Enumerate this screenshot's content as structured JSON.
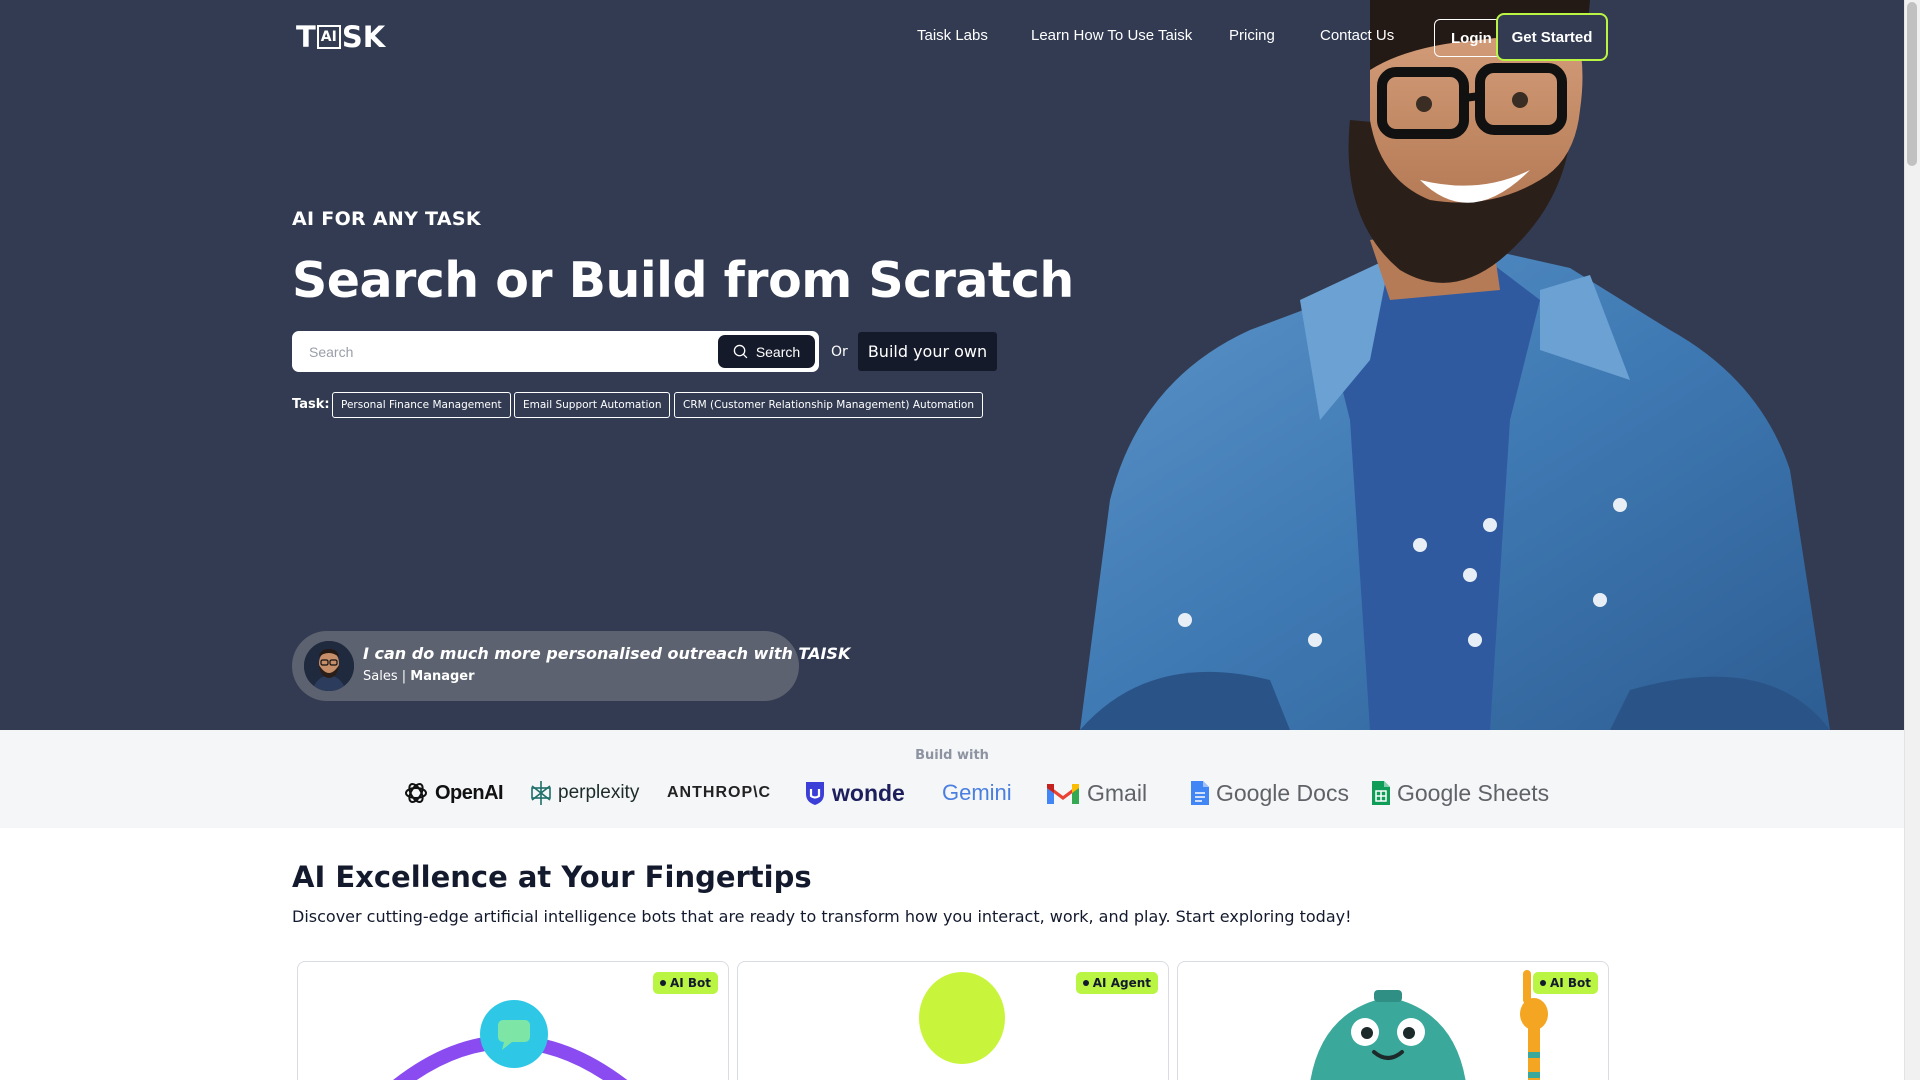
{
  "nav": {
    "logo_left": "T",
    "logo_box": "AI",
    "logo_right": "SK",
    "links": [
      "Taisk Labs",
      "Learn How To Use Taisk",
      "Pricing",
      "Contact Us"
    ],
    "login_label": "Login",
    "get_started_label": "Get Started"
  },
  "hero": {
    "eyebrow": "AI FOR ANY TASK",
    "headline": "Search or Build from Scratch",
    "search_placeholder": "Search",
    "search_value": "",
    "search_button": "Search",
    "or_text": "Or",
    "build_button": "Build your own",
    "task_label": "Task:",
    "tasks": [
      "Personal Finance Management",
      "Email Support Automation",
      "CRM (Customer Relationship Management) Automation"
    ],
    "testimonial": {
      "quote": "I can do much more personalised outreach with TAISK",
      "department": "Sales |",
      "role": "Manager"
    }
  },
  "partners": {
    "title": "Build with",
    "logos": [
      "OpenAI",
      "perplexity",
      "ANTHROP\\C",
      "wonde",
      "Gemini",
      "Gmail",
      "Google Docs",
      "Google Sheets"
    ]
  },
  "section": {
    "title": "AI Excellence at Your Fingertips",
    "description": "Discover cutting-edge artificial intelligence bots that are ready to transform how you interact, work, and play. Start exploring today!"
  },
  "cards": [
    {
      "badge": "AI Bot"
    },
    {
      "badge": "AI Agent"
    },
    {
      "badge": "AI Bot"
    }
  ],
  "colors": {
    "hero_bg": "#323b52",
    "accent": "#b9f542",
    "dark_button": "#151a2b",
    "partners_bg": "#f5f6f8"
  }
}
